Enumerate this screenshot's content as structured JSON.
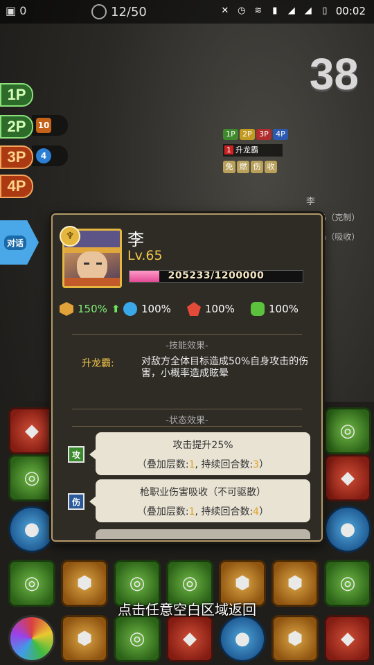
{
  "status_bar": {
    "time": "00:02",
    "left_value": "0",
    "icons": [
      "mute-icon",
      "alarm-icon",
      "wifi-icon",
      "notification-icon",
      "signal-icon",
      "signal-icon",
      "battery-icon"
    ]
  },
  "game": {
    "turn": "12/50",
    "countdown": "38",
    "players": [
      "1P",
      "2P",
      "3P",
      "4P"
    ],
    "p2_badge": "10",
    "p3_badge": "4",
    "enemy_tabs": [
      "1P",
      "2P",
      "3P",
      "4P"
    ],
    "enemy_skill_index": "1",
    "enemy_skill": "升龙霸",
    "enemy_status_icons": [
      "免",
      "燃",
      "伤",
      "收"
    ],
    "enemy_name": "李",
    "right_info": [
      "%（克制）",
      "%（吸收）"
    ],
    "talk_button": "对话",
    "bottom_hint": "点击任意空白区域返回"
  },
  "popup": {
    "name": "李",
    "level": "Lv.65",
    "hp": {
      "current": 205233,
      "max": 1200000,
      "text": "205233/1200000"
    },
    "stats": [
      {
        "icon": "attack-icon",
        "value": "150%",
        "boost": "⬆"
      },
      {
        "icon": "water-icon",
        "value": "100%"
      },
      {
        "icon": "fire-icon",
        "value": "100%"
      },
      {
        "icon": "wind-icon",
        "value": "100%"
      }
    ],
    "skill_section_title": "-技能效果-",
    "skill": {
      "name": "升龙霸:",
      "desc": "对敌方全体目标造成50%自身攻击的伤害，小概率造成眩晕"
    },
    "status_section_title": "-状态效果-",
    "statuses": [
      {
        "icon_label": "攻",
        "title": "攻击提升25%",
        "pre": "（叠加层数:",
        "stacks": "1",
        "mid": ", 持续回合数:",
        "turns": "3",
        "post": "）"
      },
      {
        "icon_label": "伤",
        "title": "枪职业伤害吸收（不可驱散）",
        "pre": "（叠加层数:",
        "stacks": "1",
        "mid": ", 持续回合数:",
        "turns": "4",
        "post": "）"
      }
    ]
  },
  "colors": {
    "accent_gold": "#f0c64a",
    "hp_pink": "#e24b95",
    "popup_border": "#b49a6a",
    "boost_green": "#6ce55b"
  }
}
